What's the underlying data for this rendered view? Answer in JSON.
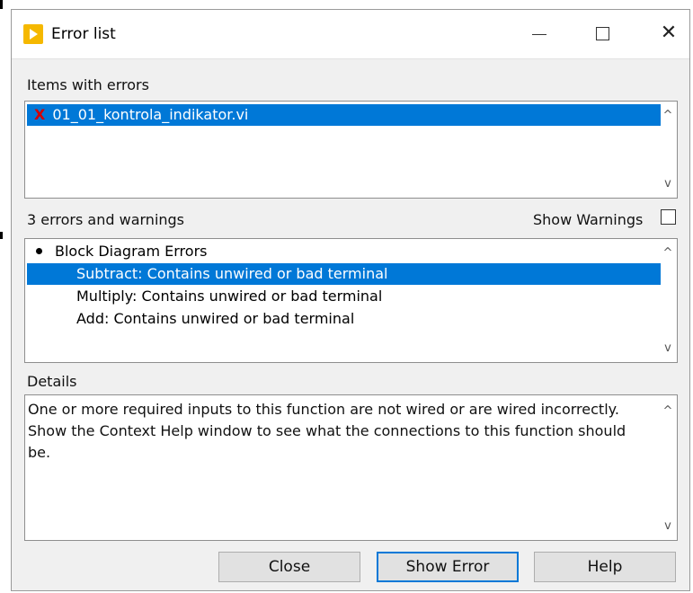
{
  "window": {
    "title": "Error list"
  },
  "items_section": {
    "label": "Items with errors",
    "items": [
      {
        "name": "01_01_kontrola_indikator.vi",
        "icon": "x-error-icon"
      }
    ]
  },
  "errors_section": {
    "count_label": "3 errors and warnings",
    "show_warnings_label": "Show Warnings",
    "show_warnings_checked": false,
    "group_label": "Block Diagram Errors",
    "errors": [
      "Subtract: Contains unwired or bad terminal",
      "Multiply: Contains unwired or bad terminal",
      "Add: Contains unwired or bad terminal"
    ]
  },
  "details_section": {
    "label": "Details",
    "text": "One or more required inputs to this function are not wired or are wired incorrectly. Show the Context Help window to see what the connections to this function should be."
  },
  "buttons": {
    "close": "Close",
    "show_error": "Show Error",
    "help": "Help"
  },
  "colors": {
    "selection": "#0078d7",
    "error_icon": "#d40000",
    "dialog_bg": "#f0f0f0"
  }
}
